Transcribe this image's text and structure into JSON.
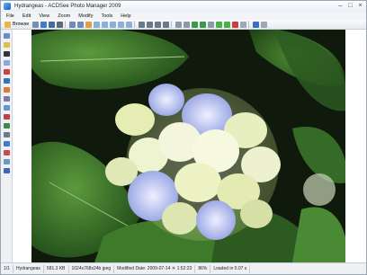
{
  "window": {
    "title": "Hydrangeas - ACDSee Photo Manager 2009",
    "controls": [
      "–",
      "□",
      "×"
    ]
  },
  "menu": [
    "File",
    "Edit",
    "View",
    "Zoom",
    "Modify",
    "Tools",
    "Help"
  ],
  "toolbar": {
    "browse_label": "Browse"
  },
  "image": {
    "subject": "Hydrangeas"
  },
  "status": {
    "index": "1/1",
    "filename": "Hydrangeas",
    "filesize": "581.3 KB",
    "dimensions": "1024x768x24b jpeg",
    "modified": "Modified Date: 2009-07-14 ☀ 1:52:23",
    "zoom": "86%",
    "loaded": "Loaded in 0.07 s"
  },
  "colors": {
    "titlebar": "#e9eef5",
    "toolbar": "#e6eaf0",
    "statusbar": "#eef0f4",
    "viewport_bg": "#0f1a0c"
  }
}
